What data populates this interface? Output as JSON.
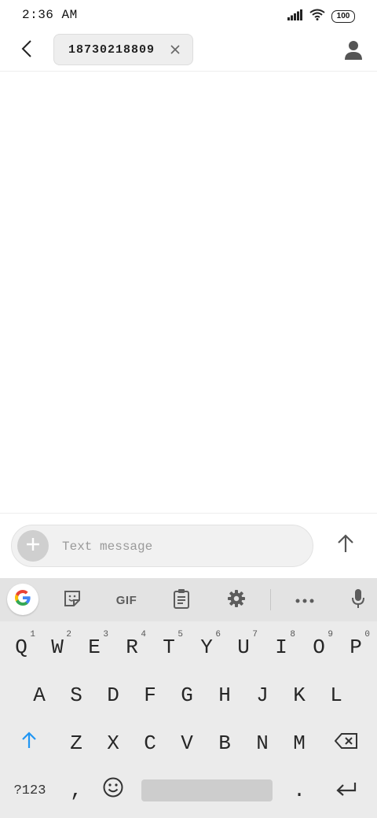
{
  "status_bar": {
    "time": "2:36 AM",
    "battery": "100",
    "icons": [
      "signal-icon",
      "wifi-icon",
      "battery-icon"
    ]
  },
  "header": {
    "recipient": "18730218809",
    "icons": [
      "back-arrow-icon",
      "close-icon",
      "person-icon"
    ]
  },
  "compose": {
    "placeholder": "Text message",
    "icons": [
      "plus-icon",
      "send-arrow-icon"
    ]
  },
  "keyboard": {
    "toolbar": {
      "gif_label": "GIF",
      "icons": [
        "google-icon",
        "sticker-icon",
        "clipboard-icon",
        "gear-icon",
        "more-icon",
        "mic-icon"
      ]
    },
    "row1": [
      "Q",
      "W",
      "E",
      "R",
      "T",
      "Y",
      "U",
      "I",
      "O",
      "P"
    ],
    "row1_hints": [
      "1",
      "2",
      "3",
      "4",
      "5",
      "6",
      "7",
      "8",
      "9",
      "0"
    ],
    "row2": [
      "A",
      "S",
      "D",
      "F",
      "G",
      "H",
      "J",
      "K",
      "L"
    ],
    "row3": [
      "Z",
      "X",
      "C",
      "V",
      "B",
      "N",
      "M"
    ],
    "row4": {
      "symbols": "?123",
      "comma": ",",
      "period": "."
    },
    "bottom_icons": [
      "shift-icon",
      "backspace-icon",
      "emoji-icon",
      "enter-icon"
    ]
  },
  "colors": {
    "shift_accent": "#2196f3",
    "keyboard_bg": "#ebebeb",
    "toolbar_bg": "#e3e3e3",
    "compose_bg": "#f1f1f1"
  }
}
